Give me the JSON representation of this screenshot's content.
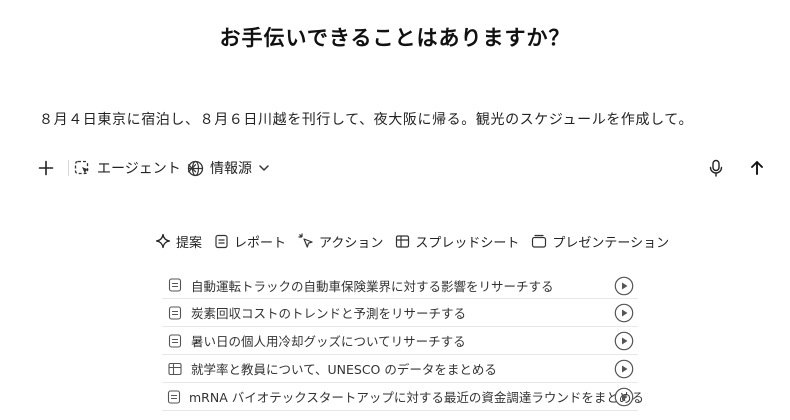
{
  "header": {
    "title": "お手伝いできることはありますか？"
  },
  "input": {
    "text": "８月４日東京に宿泊し、８月６日川越を刊行して、夜大阪に帰る。観光のスケジュールを作成して。"
  },
  "toolbar": {
    "add_icon": "plus-icon",
    "agent_label": "エージェント",
    "agent_remove": "×",
    "sources_label": "情報源",
    "mic_icon": "microphone-icon",
    "send_icon": "arrow-up-icon"
  },
  "tabs": [
    {
      "label": "提案",
      "icon": "sparkle-icon"
    },
    {
      "label": "レポート",
      "icon": "document-icon"
    },
    {
      "label": "アクション",
      "icon": "cursor-click-icon"
    },
    {
      "label": "スプレッドシート",
      "icon": "table-icon"
    },
    {
      "label": "プレゼンテーション",
      "icon": "slides-icon"
    }
  ],
  "suggestions": [
    {
      "text": "自動運転トラックの自動車保険業界に対する影響をリサーチする",
      "icon": "document-icon"
    },
    {
      "text": "炭素回収コストのトレンドと予測をリサーチする",
      "icon": "document-icon"
    },
    {
      "text": "暑い日の個人用冷却グッズについてリサーチする",
      "icon": "document-icon"
    },
    {
      "text": "就学率と教員について、UNESCO のデータをまとめる",
      "icon": "table-icon"
    },
    {
      "text": "mRNA バイオテックスタートアップに対する最近の資金調達ラウンドをまとめる",
      "icon": "document-icon"
    }
  ],
  "colors": {
    "text": "#222222",
    "icon_gray": "#555555",
    "divider": "#e8e8e8"
  }
}
